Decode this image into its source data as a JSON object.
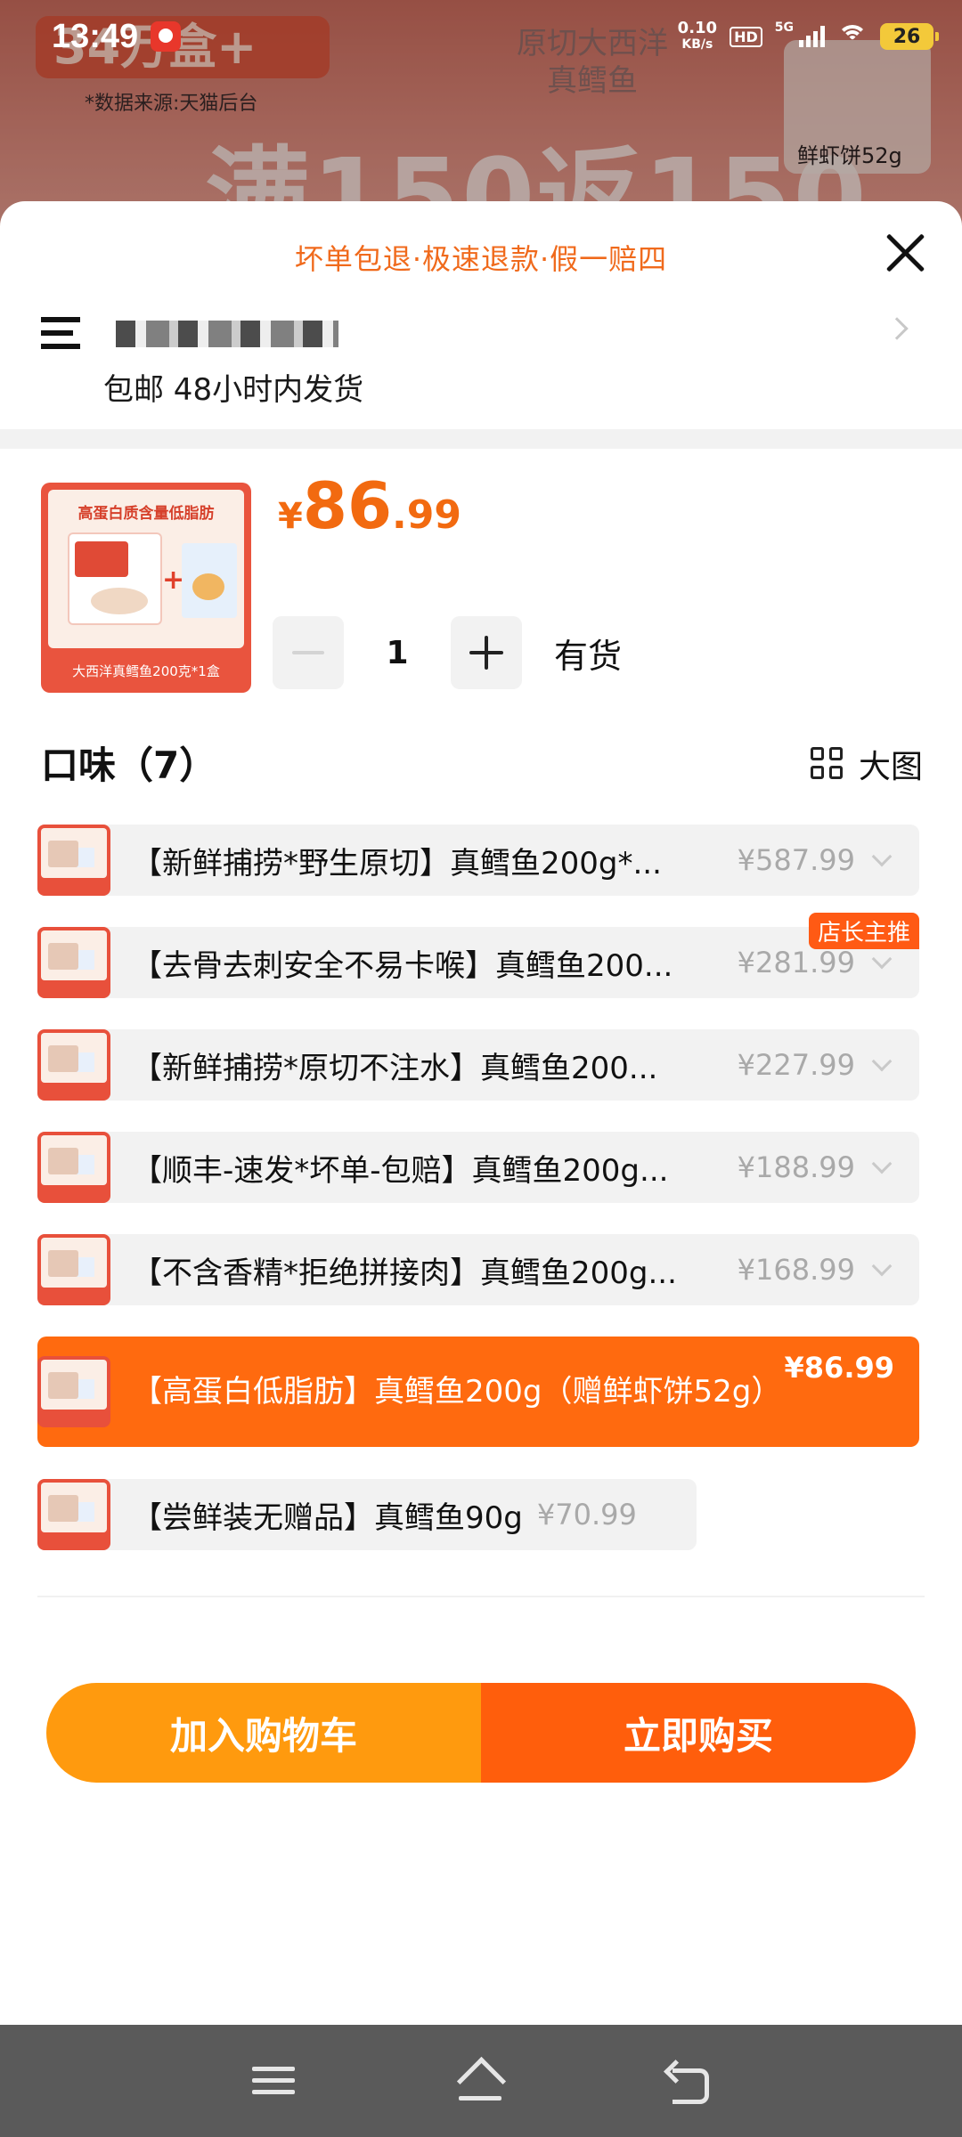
{
  "status_bar": {
    "time": "13:49",
    "net_speed_value": "0.10",
    "net_speed_unit": "KB/s",
    "hd": "HD",
    "network": "5G",
    "battery": "26"
  },
  "background": {
    "promo_tag": "34万盒+",
    "source": "*数据来源:天猫后台",
    "headline": "满150返150",
    "product_text": "原切大西洋\n真鳕鱼",
    "thumb_label": "鲜虾饼52g"
  },
  "sheet": {
    "guarantee": "坏单包退·极速退款·假一赔四",
    "address": {
      "shipping": "包邮 48小时内发货"
    },
    "product": {
      "thumb_title": "高蛋白质含量低脂肪",
      "thumb_caption": "大西洋真鳕鱼200克*1盒",
      "currency": "¥",
      "price_int": "86",
      "price_dec": ".99",
      "quantity": "1",
      "stock": "有货"
    },
    "flavor": {
      "title": "口味（7）",
      "view_toggle": "大图"
    },
    "options": [
      {
        "label": "【新鲜捕捞*野生原切】真鳕鱼200g*...",
        "price": "¥587.99",
        "badge": ""
      },
      {
        "label": "【去骨去刺安全不易卡喉】真鳕鱼200...",
        "price": "¥281.99",
        "badge": "店长主推"
      },
      {
        "label": "【新鲜捕捞*原切不注水】真鳕鱼200...",
        "price": "¥227.99",
        "badge": ""
      },
      {
        "label": "【顺丰-速发*坏单-包赔】真鳕鱼200g...",
        "price": "¥188.99",
        "badge": ""
      },
      {
        "label": "【不含香精*拒绝拼接肉】真鳕鱼200g...",
        "price": "¥168.99",
        "badge": ""
      },
      {
        "label": "【高蛋白低脂肪】真鳕鱼200g（赠鲜虾饼52g）",
        "price": "¥86.99",
        "badge": "",
        "selected": true
      },
      {
        "label": "【尝鲜装无赠品】真鳕鱼90g",
        "price": "¥70.99",
        "badge": ""
      }
    ],
    "buttons": {
      "add_to_cart": "加入购物车",
      "buy_now": "立即购买"
    }
  },
  "colors": {
    "accent": "#ff5e0c",
    "cart_button": "#ff9a0e",
    "price": "#f26a10"
  }
}
